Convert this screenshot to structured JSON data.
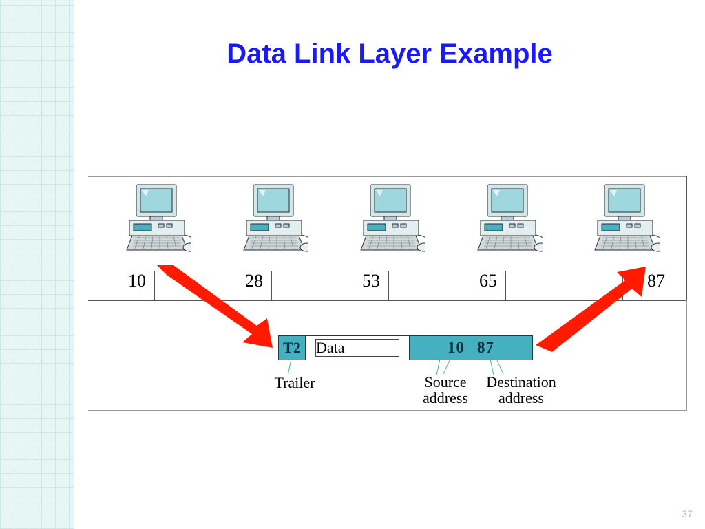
{
  "title": "Data Link Layer Example",
  "pagenum": "37",
  "computers": [
    {
      "addr": "10"
    },
    {
      "addr": "28"
    },
    {
      "addr": "53"
    },
    {
      "addr": "65"
    },
    {
      "addr": "87"
    }
  ],
  "frame": {
    "trailer": "T2",
    "data": "Data",
    "src": "10",
    "dst": "87"
  },
  "labels": {
    "trailer": "Trailer",
    "source": "Source\naddress",
    "destination": "Destination\naddress"
  },
  "colors": {
    "title": "#1919ff",
    "cell": "#45b0c0",
    "arrow": "#ff1a00"
  }
}
